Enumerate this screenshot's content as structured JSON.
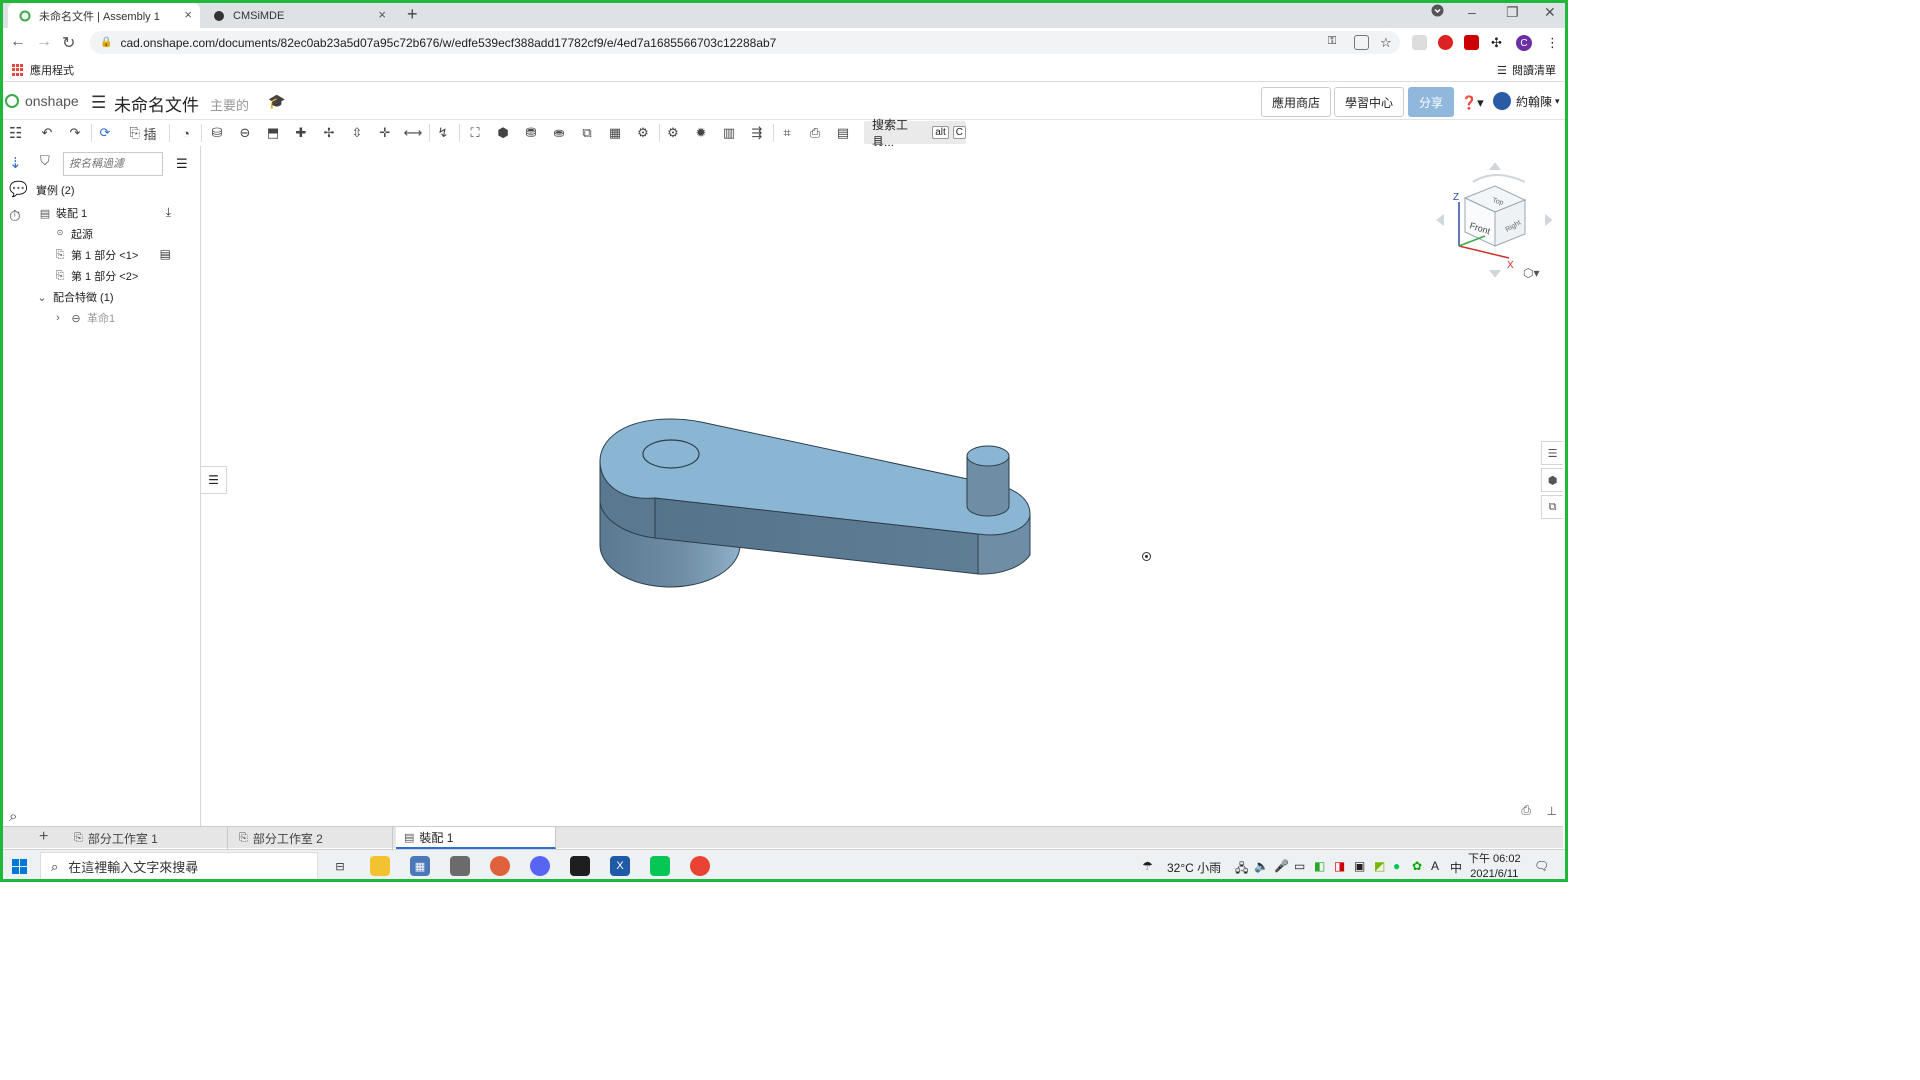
{
  "browser": {
    "tabs": [
      {
        "title": "未命名文件 | Assembly 1",
        "active": true
      },
      {
        "title": "CMSiMDE",
        "active": false
      }
    ],
    "url": "cad.onshape.com/documents/82ec0ab23a5d07a95c72b676/w/edfe539ecf388add17782cf9/e/4ed7a1685566703c12288ab7",
    "bookmarks": {
      "apps_label": "應用程式",
      "reading_list_label": "閱讀清單"
    },
    "profile_initial": "C"
  },
  "onshape": {
    "logo_text": "onshape",
    "document_title": "未命名文件",
    "branch": "主要的",
    "header_buttons": {
      "app_store": "應用商店",
      "learning": "學習中心",
      "share": "分享"
    },
    "user_name": "約翰陳"
  },
  "toolbar": {
    "insert_label": "插",
    "search_tools_label": "搜索工具...",
    "search_shortcut_alt": "alt",
    "search_shortcut_key": "C"
  },
  "panel": {
    "filter_placeholder": "按名稱過濾",
    "instances_header": "實例 (2)",
    "assembly_item": "裝配 1",
    "origin_item": "起源",
    "part1": "第 1 部分 <1>",
    "part2": "第 1 部分 <2>",
    "mate_features_header": "配合特徵 (1)",
    "mate_item": "革命1"
  },
  "viewcube": {
    "front": "Front",
    "right": "Right",
    "top": "Top",
    "axis_z": "Z",
    "axis_x": "X"
  },
  "bottom_tabs": [
    {
      "label": "部分工作室 1",
      "active": false
    },
    {
      "label": "部分工作室 2",
      "active": false
    },
    {
      "label": "裝配 1",
      "active": true
    }
  ],
  "taskbar": {
    "search_placeholder": "在這裡輸入文字來搜尋",
    "weather": "32°C  小雨",
    "ime": "中",
    "time": "下午 06:02",
    "date": "2021/6/11"
  },
  "colors": {
    "accent": "#2d6ecf",
    "share_button": "#90b8dd",
    "model_top": "#8ab6d4",
    "model_side": "#5e7d94",
    "frame": "#1fb83b"
  }
}
